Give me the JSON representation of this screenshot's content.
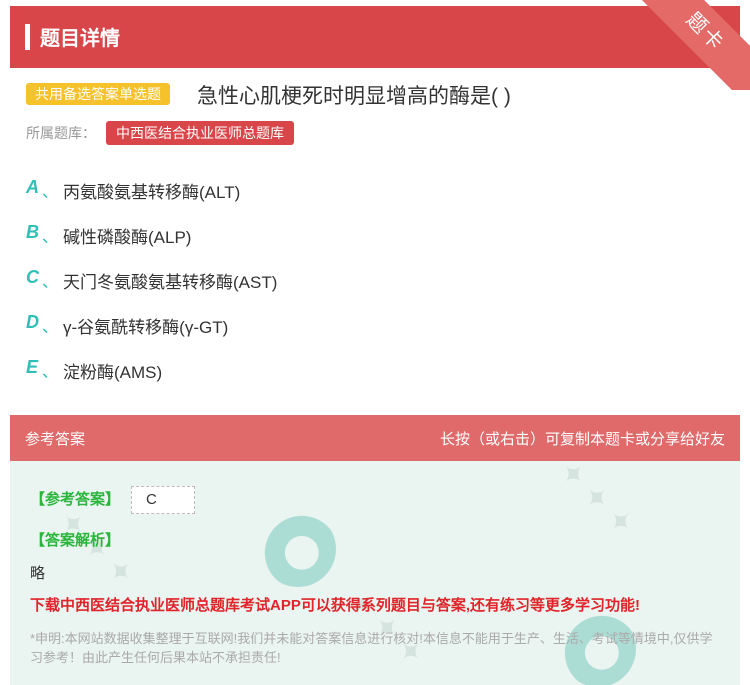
{
  "header": {
    "title": "题目详情",
    "corner_badge": "题卡"
  },
  "question": {
    "type_tag": "共用备选答案单选题",
    "text": "急性心肌梗死时明显增高的酶是( )",
    "bank_label": "所属题库：",
    "bank_name": "中西医结合执业医师总题库"
  },
  "options": [
    {
      "letter": "A",
      "sep": "、",
      "text": "丙氨酸氨基转移酶(ALT)"
    },
    {
      "letter": "B",
      "sep": "、",
      "text": "碱性磷酸酶(ALP)"
    },
    {
      "letter": "C",
      "sep": "、",
      "text": "天门冬氨酸氨基转移酶(AST)"
    },
    {
      "letter": "D",
      "sep": "、",
      "text": "γ-谷氨酰转移酶(γ-GT)"
    },
    {
      "letter": "E",
      "sep": "、",
      "text": "淀粉酶(AMS)"
    }
  ],
  "answer_section": {
    "header_left": "参考答案",
    "header_right": "长按（或右击）可复制本题卡或分享给好友",
    "answer_label": "【参考答案】",
    "answer_value": "C",
    "analysis_label": "【答案解析】",
    "analysis_text": "略",
    "promo": "下载中西医结合执业医师总题库考试APP可以获得系列题目与答案,还有练习等更多学习功能!",
    "disclaimer": "*申明:本网站数据收集整理于互联网!我们并未能对答案信息进行核对!本信息不能用于生产、生活、考试等情境中,仅供学习参考！由此产生任何后果本站不承担责任!"
  },
  "colors": {
    "primary_red": "#d9464a",
    "accent_teal": "#2fbfb6",
    "tag_yellow": "#f5c22b",
    "green_label": "#2bb53c",
    "promo_red": "#e0242a"
  }
}
